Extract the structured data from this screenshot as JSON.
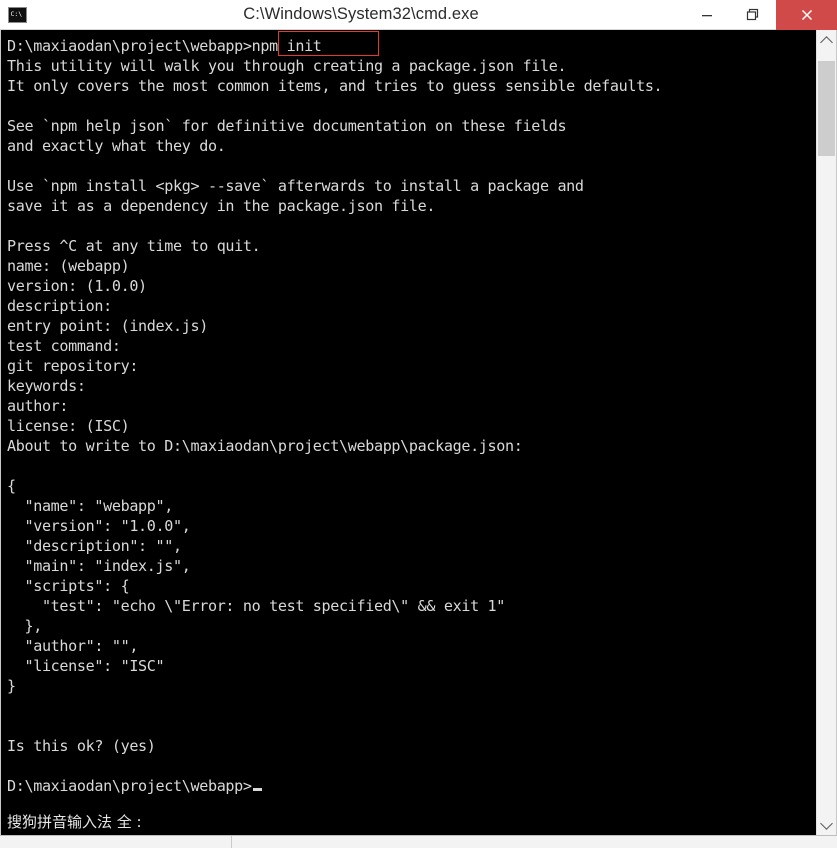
{
  "window": {
    "title": "C:\\Windows\\System32\\cmd.exe",
    "app_icon": "cmd-console-icon",
    "controls": {
      "minimize_label": "Minimize",
      "restore_label": "Restore",
      "close_label": "Close"
    },
    "close_button_color": "#d04a4a"
  },
  "console": {
    "background_color": "#000000",
    "text_color": "#d9d9d9",
    "lines": [
      "D:\\maxiaodan\\project\\webapp>npm init",
      "This utility will walk you through creating a package.json file.",
      "It only covers the most common items, and tries to guess sensible defaults.",
      "",
      "See `npm help json` for definitive documentation on these fields",
      "and exactly what they do.",
      "",
      "Use `npm install <pkg> --save` afterwards to install a package and",
      "save it as a dependency in the package.json file.",
      "",
      "Press ^C at any time to quit.",
      "name: (webapp)",
      "version: (1.0.0)",
      "description:",
      "entry point: (index.js)",
      "test command:",
      "git repository:",
      "keywords:",
      "author:",
      "license: (ISC)",
      "About to write to D:\\maxiaodan\\project\\webapp\\package.json:",
      "",
      "{",
      "  \"name\": \"webapp\",",
      "  \"version\": \"1.0.0\",",
      "  \"description\": \"\",",
      "  \"main\": \"index.js\",",
      "  \"scripts\": {",
      "    \"test\": \"echo \\\"Error: no test specified\\\" && exit 1\"",
      "  },",
      "  \"author\": \"\",",
      "  \"license\": \"ISC\"",
      "}",
      "",
      "",
      "Is this ok? (yes)",
      "",
      "D:\\maxiaodan\\project\\webapp>"
    ],
    "prompt_line": "D:\\maxiaodan\\project\\webapp>",
    "cursor": "block-cursor"
  },
  "annotation": {
    "type": "red-rectangle-highlight",
    "target_text": ">npm init",
    "color": "#e23b2e"
  },
  "ime": {
    "status_text": "搜狗拼音输入法 全 :"
  },
  "scrollbar": {
    "up_arrow": "chevron-up-icon",
    "down_arrow": "chevron-down-icon",
    "thumb_label": "scrollbar-thumb"
  }
}
